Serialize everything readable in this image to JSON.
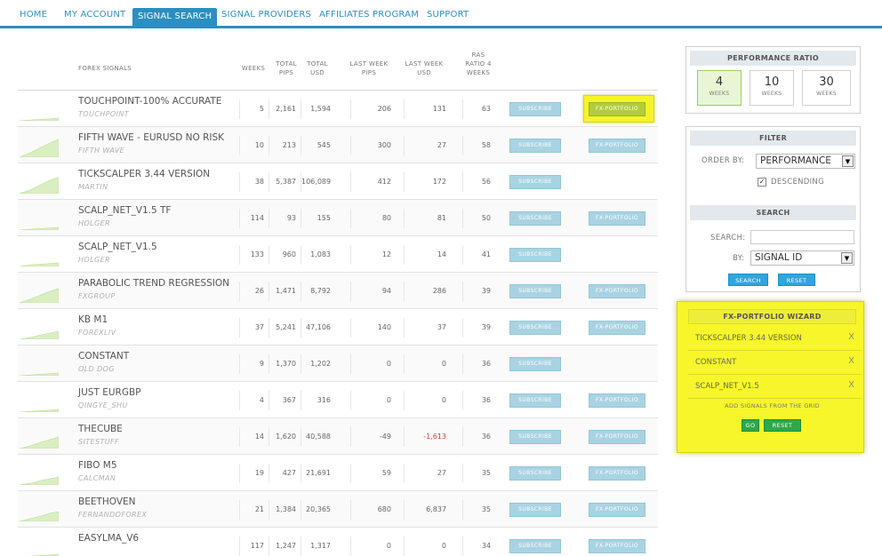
{
  "nav": {
    "items": [
      "HOME",
      "MY ACCOUNT",
      "SIGNAL SEARCH",
      "SIGNAL PROVIDERS",
      "AFFILIATES PROGRAM",
      "SUPPORT"
    ],
    "active": "SIGNAL SEARCH"
  },
  "table": {
    "headers": {
      "signals": "FOREX SIGNALS",
      "weeks": "WEEKS",
      "total_pips": "TOTAL PIPS",
      "total_usd": "TOTAL USD",
      "lw_pips": "LAST WEEK PIPS",
      "lw_usd": "LAST WEEK USD",
      "ras": "RAS RATIO 4 WEEKS"
    },
    "subscribe_label": "SUBSCRIBE",
    "fx_label": "FX-PORTFOLIO",
    "rows": [
      {
        "name": "TOUCHPOINT-100% ACCURATE",
        "provider": "TOUCHPOINT",
        "weeks": "5",
        "total_pips": "2,161",
        "total_usd": "1,594",
        "lw_pips": "206",
        "lw_usd": "131",
        "ras": "63",
        "fx": true,
        "highlight": true
      },
      {
        "name": "FIFTH WAVE - EURUSD NO RISK",
        "provider": "FIFTH WAVE",
        "weeks": "10",
        "total_pips": "213",
        "total_usd": "545",
        "lw_pips": "300",
        "lw_usd": "27",
        "ras": "58",
        "fx": true
      },
      {
        "name": "TICKSCALPER 3.44 VERSION",
        "provider": "MARTIN",
        "weeks": "38",
        "total_pips": "5,387",
        "total_usd": "106,089",
        "lw_pips": "412",
        "lw_usd": "172",
        "ras": "56",
        "fx": false
      },
      {
        "name": "SCALP_NET_V1.5 TF",
        "provider": "HOLGER",
        "weeks": "114",
        "total_pips": "93",
        "total_usd": "155",
        "lw_pips": "80",
        "lw_usd": "81",
        "ras": "50",
        "fx": true
      },
      {
        "name": "SCALP_NET_V1.5",
        "provider": "HOLGER",
        "weeks": "133",
        "total_pips": "960",
        "total_usd": "1,083",
        "lw_pips": "12",
        "lw_usd": "14",
        "ras": "41",
        "fx": false
      },
      {
        "name": "PARABOLIC TREND REGRESSION",
        "provider": "FXGROUP",
        "weeks": "26",
        "total_pips": "1,471",
        "total_usd": "8,792",
        "lw_pips": "94",
        "lw_usd": "286",
        "ras": "39",
        "fx": true
      },
      {
        "name": "KB M1",
        "provider": "FOREXLIV",
        "weeks": "37",
        "total_pips": "5,241",
        "total_usd": "47,106",
        "lw_pips": "140",
        "lw_usd": "37",
        "ras": "39",
        "fx": true
      },
      {
        "name": "CONSTANT",
        "provider": "OLD DOG",
        "weeks": "9",
        "total_pips": "1,370",
        "total_usd": "1,202",
        "lw_pips": "0",
        "lw_usd": "0",
        "ras": "36",
        "fx": false
      },
      {
        "name": "JUST EURGBP",
        "provider": "QINGYE_SHU",
        "weeks": "4",
        "total_pips": "367",
        "total_usd": "316",
        "lw_pips": "0",
        "lw_usd": "0",
        "ras": "36",
        "fx": true
      },
      {
        "name": "THECUBE",
        "provider": "SITESTUFF",
        "weeks": "14",
        "total_pips": "1,620",
        "total_usd": "40,588",
        "lw_pips": "-49",
        "lw_usd": "-1,613",
        "ras": "36",
        "fx": true,
        "neg": true
      },
      {
        "name": "FIBO M5",
        "provider": "CALCMAN",
        "weeks": "19",
        "total_pips": "427",
        "total_usd": "21,691",
        "lw_pips": "59",
        "lw_usd": "27",
        "ras": "35",
        "fx": true
      },
      {
        "name": "BEETHOVEN",
        "provider": "FERNANDOFOREX",
        "weeks": "21",
        "total_pips": "1,384",
        "total_usd": "20,365",
        "lw_pips": "680",
        "lw_usd": "6,837",
        "ras": "35",
        "fx": true
      },
      {
        "name": "EASYLMA_V6",
        "provider": "",
        "weeks": "117",
        "total_pips": "1,247",
        "total_usd": "1,317",
        "lw_pips": "0",
        "lw_usd": "0",
        "ras": "34",
        "fx": true
      }
    ]
  },
  "performance": {
    "title": "PERFORMANCE RATIO",
    "options": [
      {
        "value": "4",
        "label": "WEEKS",
        "active": true
      },
      {
        "value": "10",
        "label": "WEEKS",
        "active": false
      },
      {
        "value": "30",
        "label": "WEEKS",
        "active": false
      }
    ]
  },
  "filter": {
    "title": "FILTER",
    "order_label": "ORDER BY:",
    "order_value": "PERFORMANCE",
    "descending_label": "DESCENDING",
    "descending_checked": true,
    "search_title": "SEARCH",
    "search_label": "SEARCH:",
    "search_value": "",
    "by_label": "BY:",
    "by_value": "SIGNAL ID",
    "search_button": "SEARCH",
    "reset_button": "RESET"
  },
  "wizard": {
    "title": "FX-PORTFOLIO WIZARD",
    "items": [
      "TICKSCALPER 3.44 VERSION",
      "CONSTANT",
      "SCALP_NET_V1.5"
    ],
    "remove_label": "X",
    "hint": "ADD SIGNALS FROM THE GRID",
    "go_button": "GO",
    "reset_button": "RESET"
  },
  "colors": {
    "accent": "#2b8fbf",
    "button": "#a9d3e2",
    "highlight": "#f6f62a",
    "negative": "#d03a3a",
    "go": "#2da84a"
  }
}
